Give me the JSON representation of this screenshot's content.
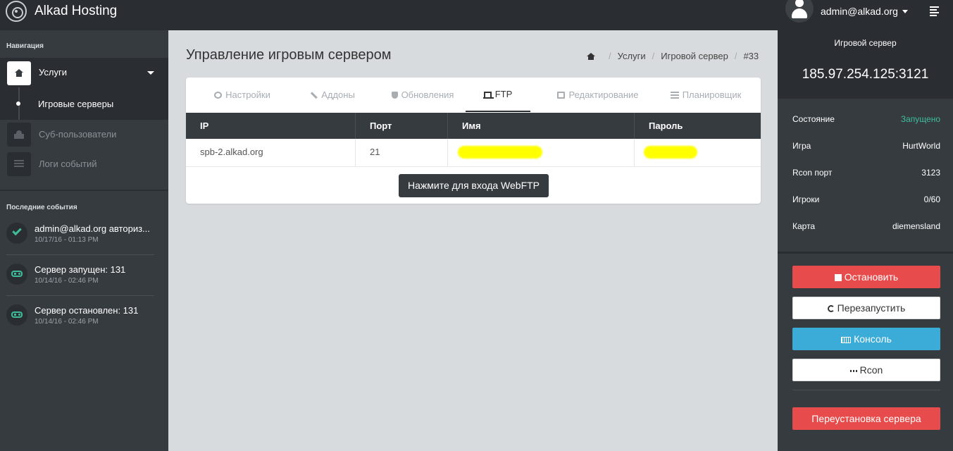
{
  "app": {
    "title": "Alkad Hosting"
  },
  "user": {
    "name": "admin@alkad.org"
  },
  "sidebar": {
    "nav_heading": "Навигация",
    "items": [
      {
        "label": "Услуги"
      },
      {
        "label": "Игровые серверы"
      },
      {
        "label": "Суб-пользователи"
      },
      {
        "label": "Логи событий"
      }
    ],
    "events_heading": "Последние события",
    "events": [
      {
        "title": "admin@alkad.org авториз...",
        "time": "10/17/16 - 01:13 PM",
        "icon": "check-icon"
      },
      {
        "title": "Сервер запущен: 131",
        "time": "10/14/16 - 02:46 PM",
        "icon": "gamepad-icon"
      },
      {
        "title": "Сервер остановлен: 131",
        "time": "10/14/16 - 02:46 PM",
        "icon": "gamepad-icon"
      }
    ]
  },
  "main": {
    "title": "Управление игровым сервером",
    "breadcrumb": [
      "Услуги",
      "Игровой сервер",
      "#33"
    ],
    "tabs": [
      {
        "label": "Настройки",
        "icon": "gears-icon"
      },
      {
        "label": "Аддоны",
        "icon": "wrench-icon"
      },
      {
        "label": "Обновления",
        "icon": "shield-icon"
      },
      {
        "label": "FTP",
        "icon": "laptop-icon",
        "active": true
      },
      {
        "label": "Редактирование",
        "icon": "edit-icon"
      },
      {
        "label": "Планировщик",
        "icon": "tasks-icon"
      }
    ],
    "table": {
      "columns": [
        "IP",
        "Порт",
        "Имя",
        "Пароль"
      ],
      "rows": [
        [
          "spb-2.alkad.org",
          "21",
          "",
          ""
        ]
      ]
    },
    "webftp_button": "Нажмите для входа WebFTP"
  },
  "server": {
    "heading": "Игровой сервер",
    "address": "185.97.254.125:3121",
    "info": [
      {
        "key": "Состояние",
        "value": "Запущено"
      },
      {
        "key": "Игра",
        "value": "HurtWorld"
      },
      {
        "key": "Rcon порт",
        "value": "3123"
      },
      {
        "key": "Игроки",
        "value": "0/60"
      },
      {
        "key": "Карта",
        "value": "diemensland"
      }
    ],
    "buttons": {
      "stop": "Остановить",
      "restart": "Перезапустить",
      "console": "Консоль",
      "rcon": "Rcon",
      "reinstall": "Переустановка сервера"
    }
  },
  "colors": {
    "topbar": "#2a2d31",
    "sidebar": "#363b40",
    "status_running": "#3ebd9b",
    "danger": "#e84b4b",
    "info": "#3bacd8",
    "redaction": "#ffff00"
  }
}
